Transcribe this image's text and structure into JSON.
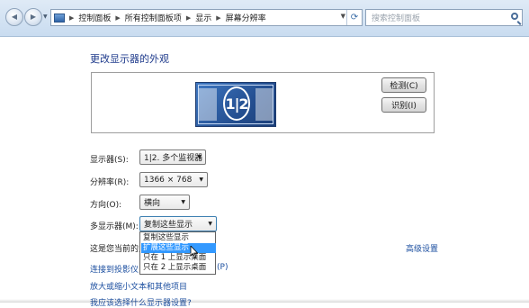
{
  "nav": {
    "back_glyph": "◀",
    "forward_glyph": "▶",
    "dropdown_glyph": "▼",
    "breadcrumbs": [
      "控制面板",
      "所有控制面板项",
      "显示",
      "屏幕分辨率"
    ],
    "breadcrumb_separator": "▶",
    "refresh_glyph": "⟳",
    "search_placeholder": "搜索控制面板"
  },
  "page": {
    "title": "更改显示器的外观",
    "monitor_label": "1|2",
    "detect_button": "检测(C)",
    "identify_button": "识别(I)"
  },
  "settings": {
    "display": {
      "label": "显示器(S):",
      "value": "1|2. 多个监视器"
    },
    "resolution": {
      "label": "分辨率(R):",
      "value": "1366 × 768"
    },
    "orientation": {
      "label": "方向(O):",
      "value": "横向"
    },
    "multiple_displays": {
      "label": "多显示器(M):",
      "value": "复制这些显示",
      "options": [
        "复制这些显示",
        "扩展这些显示",
        "只在 1 上显示桌面",
        "只在 2 上显示桌面"
      ],
      "highlighted_option": 1
    },
    "arrow_glyph": "▼"
  },
  "footer": {
    "current_display_text": "这是您当前的主",
    "advanced_settings_link": "高级设置",
    "projector_link": "连接到投影仪",
    "projector_suffix": "(P)",
    "text_size_link": "放大或缩小文本和其他项目",
    "help_link": "我应该选择什么显示器设置?"
  },
  "colors": {
    "link": "#1c4fa0",
    "title": "#1f3b8c",
    "highlight": "#3399ff",
    "topbar": "#c9dcf0"
  }
}
